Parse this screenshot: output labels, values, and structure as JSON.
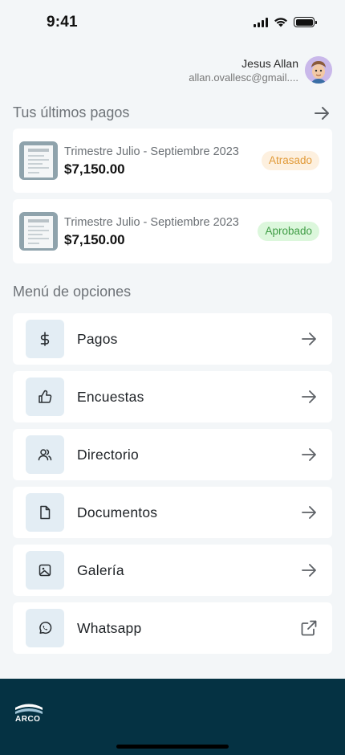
{
  "status_bar": {
    "time": "9:41"
  },
  "profile": {
    "name": "Jesus Allan",
    "email": "allan.ovallesc@gmail...."
  },
  "payments": {
    "section_title": "Tus últimos pagos",
    "items": [
      {
        "period": "Trimestre Julio - Septiembre 2023",
        "amount": "$7,150.00",
        "status": "Atrasado",
        "status_color": "#e19a38"
      },
      {
        "period": "Trimestre Julio - Septiembre 2023",
        "amount": "$7,150.00",
        "status": "Aprobado",
        "status_color": "#3e9c44"
      }
    ]
  },
  "menu": {
    "section_title": "Menú de opciones",
    "items": [
      {
        "label": "Pagos",
        "icon": "dollar-icon",
        "action_icon": "arrow-right-icon"
      },
      {
        "label": "Encuestas",
        "icon": "thumbs-up-icon",
        "action_icon": "arrow-right-icon"
      },
      {
        "label": "Directorio",
        "icon": "users-icon",
        "action_icon": "arrow-right-icon"
      },
      {
        "label": "Documentos",
        "icon": "document-icon",
        "action_icon": "arrow-right-icon"
      },
      {
        "label": "Galería",
        "icon": "image-icon",
        "action_icon": "arrow-right-icon"
      },
      {
        "label": "Whatsapp",
        "icon": "whatsapp-icon",
        "action_icon": "external-link-icon"
      }
    ]
  },
  "footer": {
    "logo_text": "ARCO"
  },
  "colors": {
    "footer_bg": "#053243",
    "icon_tile_bg": "#e3edf4",
    "late_badge_bg": "#fdf0df",
    "approved_badge_bg": "#dcf7dc"
  }
}
